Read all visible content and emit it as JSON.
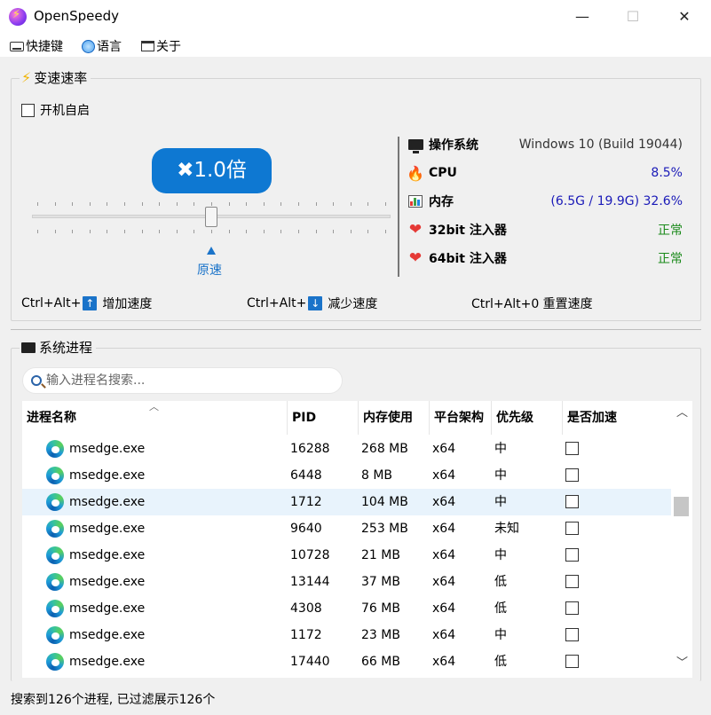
{
  "window": {
    "title": "OpenSpeedy",
    "minimize": "—",
    "maximize": "☐",
    "close": "✕"
  },
  "menu": {
    "shortcuts": "快捷键",
    "language": "语言",
    "about": "关于"
  },
  "speed_group": {
    "title": "变速速率",
    "autostart_label": "开机自启",
    "autostart_checked": false,
    "speed_display": "✖1.0倍",
    "slider_value": 1.0,
    "origin_label": "原速"
  },
  "system_info": {
    "os_label": "操作系统",
    "os_value": "Windows 10 (Build 19044)",
    "cpu_label": "CPU",
    "cpu_value": "8.5%",
    "mem_label": "内存",
    "mem_value": "(6.5G / 19.9G) 32.6%",
    "inj32_label": "32bit 注入器",
    "inj32_value": "正常",
    "inj64_label": "64bit 注入器",
    "inj64_value": "正常",
    "value_color_blue": "#1a1ab8",
    "value_color_green": "#1a8a1a"
  },
  "hotkeys": {
    "increase_prefix": "Ctrl+Alt+",
    "increase_key": "↑",
    "increase_label": "增加速度",
    "decrease_prefix": "Ctrl+Alt+",
    "decrease_key": "↓",
    "decrease_label": "减少速度",
    "reset_label": "Ctrl+Alt+0 重置速度"
  },
  "process_group": {
    "title": "系统进程",
    "search_placeholder": "输入进程名搜索...",
    "columns": [
      "进程名称",
      "PID",
      "内存使用",
      "平台架构",
      "优先级",
      "是否加速"
    ],
    "rows": [
      {
        "name": "msedge.exe",
        "pid": "16288",
        "mem": "268 MB",
        "arch": "x64",
        "priority": "中",
        "accelerated": false
      },
      {
        "name": "msedge.exe",
        "pid": "6448",
        "mem": "8 MB",
        "arch": "x64",
        "priority": "中",
        "accelerated": false
      },
      {
        "name": "msedge.exe",
        "pid": "1712",
        "mem": "104 MB",
        "arch": "x64",
        "priority": "中",
        "accelerated": false
      },
      {
        "name": "msedge.exe",
        "pid": "9640",
        "mem": "253 MB",
        "arch": "x64",
        "priority": "未知",
        "accelerated": false
      },
      {
        "name": "msedge.exe",
        "pid": "10728",
        "mem": "21 MB",
        "arch": "x64",
        "priority": "中",
        "accelerated": false
      },
      {
        "name": "msedge.exe",
        "pid": "13144",
        "mem": "37 MB",
        "arch": "x64",
        "priority": "低",
        "accelerated": false
      },
      {
        "name": "msedge.exe",
        "pid": "4308",
        "mem": "76 MB",
        "arch": "x64",
        "priority": "低",
        "accelerated": false
      },
      {
        "name": "msedge.exe",
        "pid": "1172",
        "mem": "23 MB",
        "arch": "x64",
        "priority": "中",
        "accelerated": false
      },
      {
        "name": "msedge.exe",
        "pid": "17440",
        "mem": "66 MB",
        "arch": "x64",
        "priority": "低",
        "accelerated": false
      }
    ],
    "selected_row_index": 2
  },
  "status": {
    "text": "搜索到126个进程, 已过滤展示126个"
  }
}
